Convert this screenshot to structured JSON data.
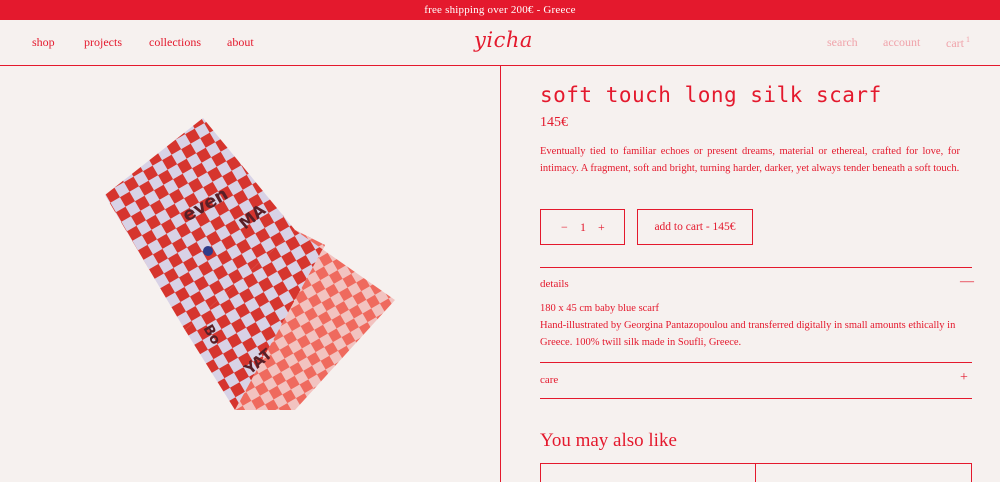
{
  "announcement": "free shipping over 200€ - Greece",
  "nav": {
    "shop": "shop",
    "projects": "projects",
    "collections": "collections",
    "about": "about",
    "logo": "yicha",
    "search": "search",
    "account": "account",
    "cart": "cart",
    "cart_count": "1"
  },
  "product": {
    "title": "soft touch long silk scarf",
    "price": "145€",
    "description": "Eventually tied to familiar echoes or present dreams, material or ethereal, crafted for love, for intimacy. A fragment, soft and bright, turning harder, darker, yet always tender beneath a soft touch.",
    "quantity": "1",
    "minus": "−",
    "plus": "+",
    "add_to_cart": "add to cart - 145€"
  },
  "accordion": {
    "details_label": "details",
    "details_icon": "—",
    "details_line1": "180 x 45 cm baby blue scarf",
    "details_line2": "Hand-illustrated by Georgina Pantazopoulou and transferred digitally in small amounts ethically in Greece. 100% twill silk made in Soufli, Greece.",
    "care_label": "care",
    "care_icon": "+"
  },
  "related": {
    "heading": "You may also like"
  },
  "colors": {
    "brand_red": "#e4192d",
    "background": "#f6f1ef",
    "muted_pink": "#f0a3aa"
  }
}
